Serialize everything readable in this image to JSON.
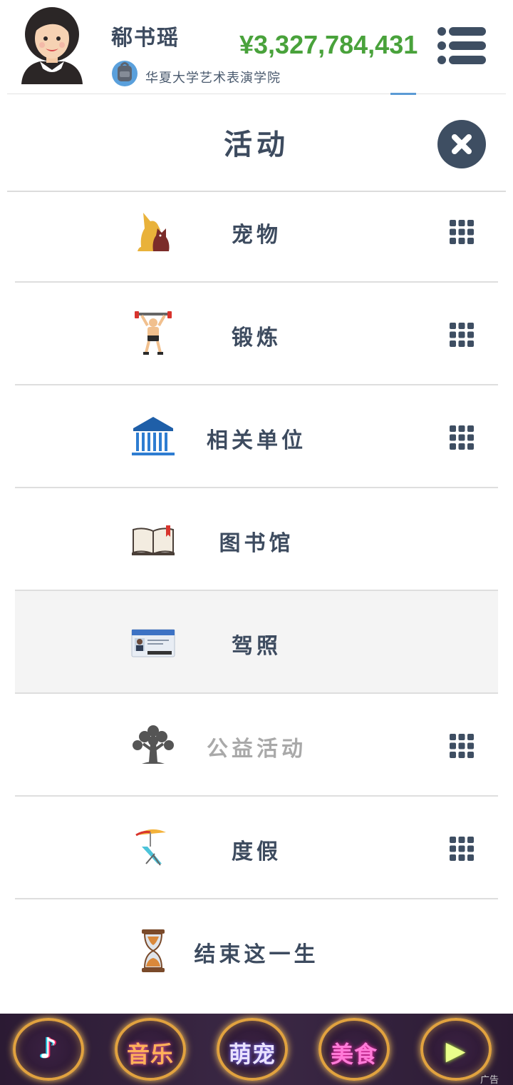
{
  "header": {
    "player_name": "郗书瑶",
    "school": "华夏大学艺术表演学院",
    "money": "¥3,327,784,431"
  },
  "modal": {
    "title": "活动"
  },
  "items": [
    {
      "label": "宠物",
      "icon": "pet-icon",
      "has_grid": true
    },
    {
      "label": "锻炼",
      "icon": "weightlifter-icon",
      "has_grid": true
    },
    {
      "label": "相关单位",
      "icon": "institution-building-icon",
      "has_grid": true
    },
    {
      "label": "图书馆",
      "icon": "open-book-icon",
      "has_grid": false
    },
    {
      "label": "驾照",
      "icon": "drivers-license-icon",
      "has_grid": false
    },
    {
      "label": "公益活动",
      "icon": "tree-icon",
      "has_grid": true
    },
    {
      "label": "度假",
      "icon": "beach-chair-icon",
      "has_grid": true
    },
    {
      "label": "结束这一生",
      "icon": "hourglass-icon",
      "has_grid": false
    }
  ],
  "bottom_bar": {
    "buttons": [
      {
        "label": "♪",
        "name": "tiktok-button"
      },
      {
        "label": "音乐",
        "name": "music-button"
      },
      {
        "label": "萌宠",
        "name": "cute-pets-button"
      },
      {
        "label": "美食",
        "name": "food-button"
      },
      {
        "label": "▶",
        "name": "play-button"
      }
    ],
    "ad_label": "广告"
  },
  "colors": {
    "money": "#49a23b",
    "text": "#3d4b5f",
    "muted": "#a9a9a9",
    "highlight_row": "#f4f4f4",
    "bar_ring": "#e1a23f"
  }
}
